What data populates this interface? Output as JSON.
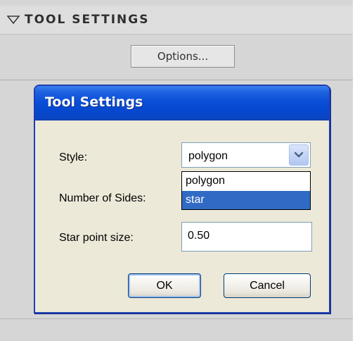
{
  "panel": {
    "header_title": "TOOL SETTINGS",
    "options_button_label": "Options..."
  },
  "dialog": {
    "title": "Tool Settings",
    "style_label": "Style:",
    "style_value": "polygon",
    "style_options": [
      "polygon",
      "star"
    ],
    "highlighted_option": "star",
    "sides_label": "Number of Sides:",
    "star_point_label": "Star point size:",
    "star_point_value": "0.50",
    "ok_label": "OK",
    "cancel_label": "Cancel"
  },
  "colors": {
    "titlebar_blue": "#0a4fd8",
    "dialog_bg": "#ece9d8",
    "selection_blue": "#316ac5",
    "panel_gray": "#d6d6d6"
  },
  "icons": {
    "collapse": "triangle-down-icon",
    "dropdown": "chevron-down-icon"
  }
}
